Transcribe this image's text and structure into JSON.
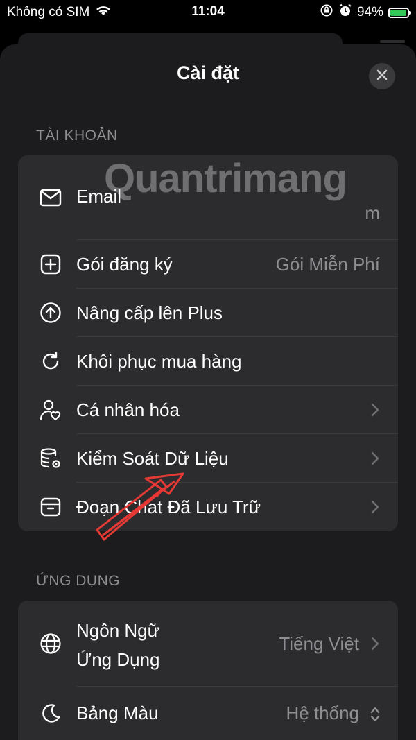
{
  "status_bar": {
    "carrier": "Không có SIM",
    "time": "11:04",
    "battery": "94%"
  },
  "header": {
    "title": "Cài đặt"
  },
  "sections": [
    {
      "title": "TÀI KHOẢN",
      "rows": [
        {
          "label": "Email",
          "value": "m"
        },
        {
          "label": "Gói đăng ký",
          "value": "Gói Miễn Phí"
        },
        {
          "label": "Nâng cấp lên Plus"
        },
        {
          "label": "Khôi phục mua hàng"
        },
        {
          "label": "Cá nhân hóa"
        },
        {
          "label": "Kiểm Soát Dữ Liệu"
        },
        {
          "label": "Đoạn Chat Đã Lưu Trữ"
        }
      ]
    },
    {
      "title": "ỨNG DỤNG",
      "rows": [
        {
          "label": "Ngôn Ngữ Ứng Dụng",
          "label_line1": "Ngôn Ngữ",
          "label_line2": "Ứng Dụng",
          "value": "Tiếng Việt"
        },
        {
          "label": "Bảng Màu",
          "value": "Hệ thống"
        }
      ]
    }
  ],
  "watermark": "Quantrimang",
  "icons": [
    "wifi-icon",
    "lock-rotation-icon",
    "alarm-icon",
    "battery-icon",
    "close-icon",
    "mail-icon",
    "plus-square-icon",
    "arrow-up-circle-icon",
    "refresh-icon",
    "person-heart-icon",
    "database-gear-icon",
    "archive-icon",
    "globe-icon",
    "moon-icon",
    "chevron-right-icon",
    "chevron-updown-icon"
  ],
  "colors": {
    "sheet": "#1c1c1e",
    "group": "#2c2c2e",
    "secondary_text": "#8e8e93",
    "battery": "#34c759",
    "annotation_arrow": "#e53935"
  }
}
